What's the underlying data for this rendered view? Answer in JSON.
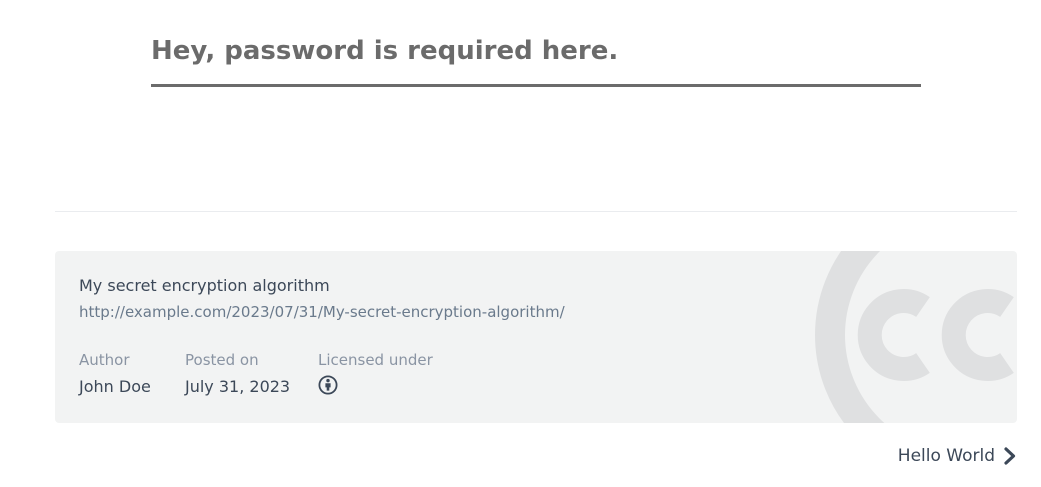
{
  "password": {
    "placeholder": "Hey, password is required here.",
    "value": ""
  },
  "license": {
    "title": "My secret encryption algorithm",
    "url": "http://example.com/2023/07/31/My-secret-encryption-algorithm/",
    "author_label": "Author",
    "author_value": "John Doe",
    "posted_label": "Posted on",
    "posted_value": "July 31, 2023",
    "licensed_label": "Licensed under",
    "license_icon": "cc-by-icon",
    "watermark_icon": "creative-commons-icon"
  },
  "nav": {
    "next_label": "Hello World",
    "next_icon": "chevron-right-icon"
  },
  "colors": {
    "text": "#3c4858",
    "muted": "#8a94a3",
    "link": "#6a7a8c",
    "card_bg": "#f2f3f3",
    "password_text": "#6b6b6b"
  }
}
